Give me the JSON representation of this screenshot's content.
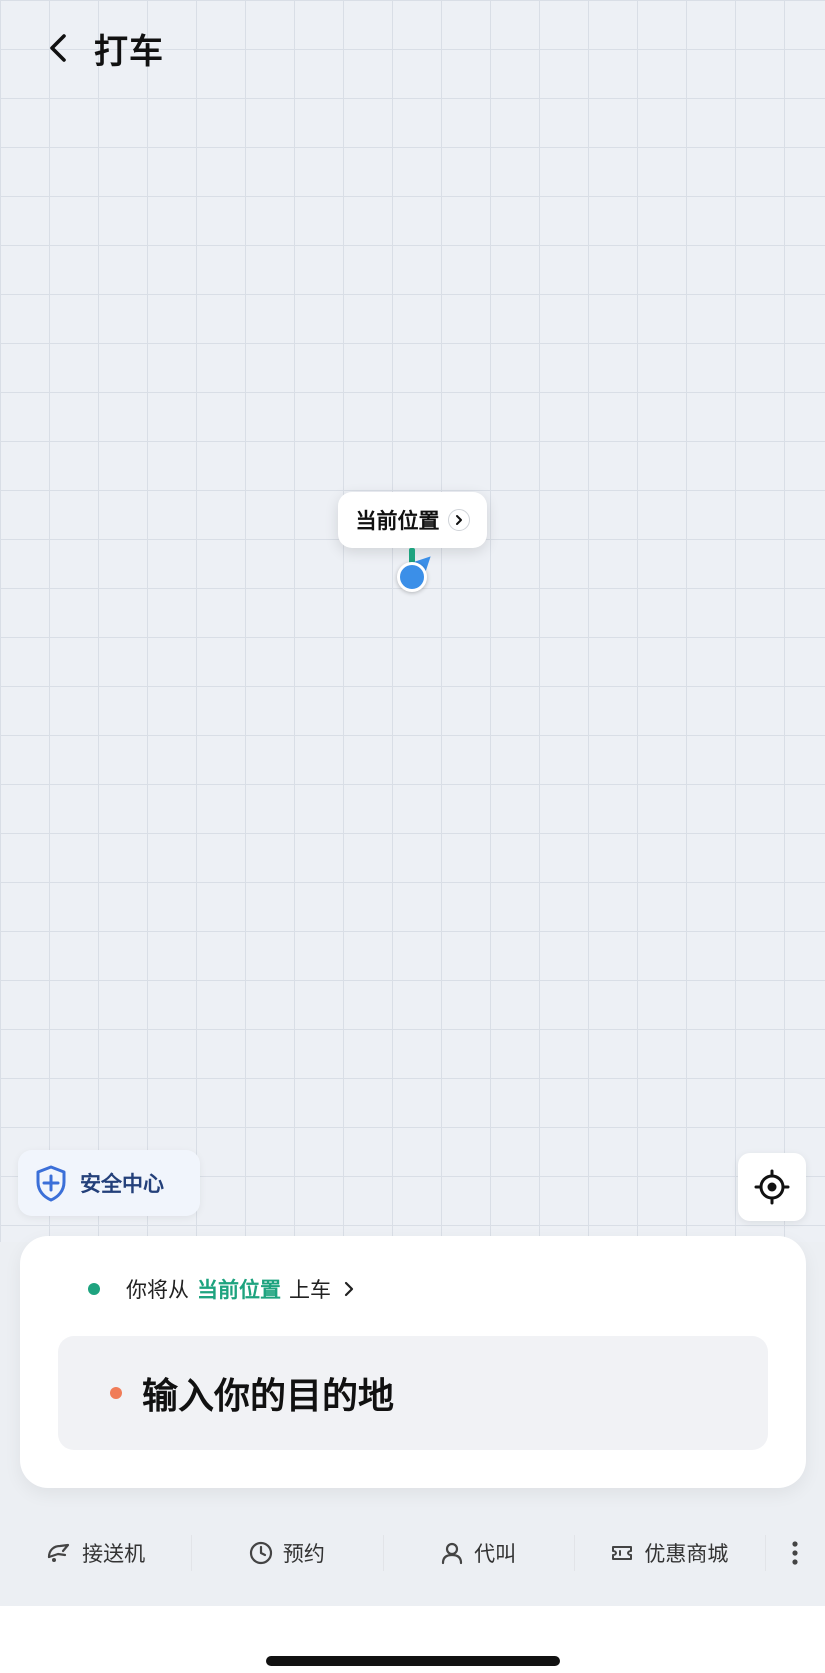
{
  "header": {
    "title": "打车"
  },
  "map": {
    "current_location_label": "当前位置"
  },
  "safety": {
    "label": "安全中心"
  },
  "trip": {
    "pickup_prefix": "你将从",
    "pickup_location": "当前位置",
    "pickup_suffix": "上车",
    "destination_placeholder": "输入你的目的地"
  },
  "services": [
    {
      "label": "接送机",
      "icon": "airplane-icon"
    },
    {
      "label": "预约",
      "icon": "clock-icon"
    },
    {
      "label": "代叫",
      "icon": "person-icon"
    },
    {
      "label": "优惠商城",
      "icon": "ticket-icon"
    }
  ],
  "colors": {
    "accent_green": "#1ea37f",
    "pin_blue": "#3b8fe8",
    "destination_dot": "#f07c58",
    "safety_text": "#24407a"
  }
}
